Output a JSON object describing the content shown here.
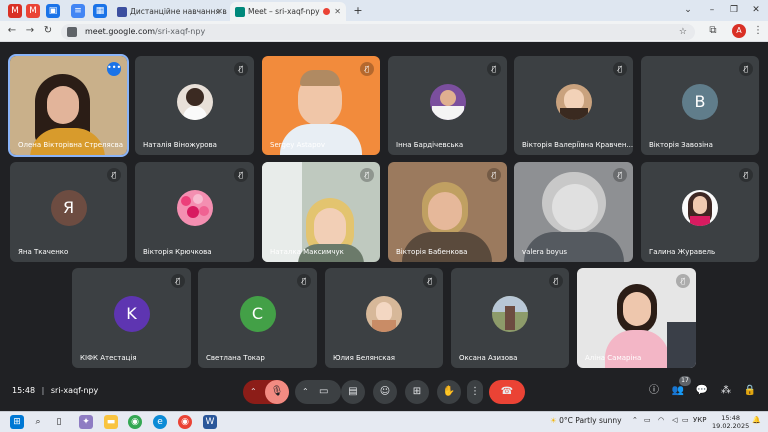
{
  "browser": {
    "tabs": [
      {
        "label": "",
        "color": "#d93025"
      },
      {
        "label": "",
        "color": "#ea4335"
      },
      {
        "label": "",
        "color": "#1a73e8"
      },
      {
        "label": "",
        "color": "#4285f4"
      },
      {
        "label": "",
        "color": "#1a73e8"
      },
      {
        "label": "Дистанційне навчання в ВСП",
        "color": "#3c4fa0"
      },
      {
        "label": "Meet – sri-xaqf-npy",
        "color": "#00897b"
      }
    ],
    "new_tab": "+",
    "window_controls": [
      "⌄",
      "–",
      "❐",
      "✕"
    ],
    "url_host": "meet.google.com",
    "url_path": "/sri-xaqf-npy",
    "profile_initial": "A"
  },
  "participants": [
    {
      "name": "Олена Вікторівна Стрелясва",
      "type": "video",
      "speaking": true
    },
    {
      "name": "Наталія Віножурова",
      "type": "photo",
      "color": "#e8e0d8"
    },
    {
      "name": "Sergey Astapov",
      "type": "video"
    },
    {
      "name": "Інна Бардічевська",
      "type": "photo",
      "color": "#7b4f9e"
    },
    {
      "name": "Вікторія Валеріївна Кравчен...",
      "type": "photo",
      "color": "#c9a27e"
    },
    {
      "name": "Вікторія Завозіна",
      "type": "letter",
      "letter": "B",
      "color": "#607d8b"
    },
    {
      "name": "Яна Ткаченко",
      "type": "letter",
      "letter": "Я",
      "color": "#6d4c41"
    },
    {
      "name": "Вікторія Крючкова",
      "type": "photo",
      "color": "#f48fb1"
    },
    {
      "name": "Наталка Максимчук",
      "type": "video"
    },
    {
      "name": "Вікторія Бабенкова",
      "type": "video"
    },
    {
      "name": "valera boyus",
      "type": "video"
    },
    {
      "name": "Галина Журавель",
      "type": "photo",
      "color": "#3e2723"
    },
    {
      "name": "КІФК Атестація",
      "type": "letter",
      "letter": "K",
      "color": "#5e35b1"
    },
    {
      "name": "Светлана Токар",
      "type": "letter",
      "letter": "C",
      "color": "#43a047"
    },
    {
      "name": "Юлия Белянская",
      "type": "photo",
      "color": "#d7b899"
    },
    {
      "name": "Оксана Азизова",
      "type": "photo",
      "color": "#8d9b6a"
    },
    {
      "name": "Аліна Самаріна",
      "type": "video"
    }
  ],
  "meeting": {
    "time": "15:48",
    "code": "sri-xaqf-npy",
    "people_count": "17"
  },
  "taskbar": {
    "weather": "0°C  Partly sunny",
    "lang": "УКР",
    "time": "15:48",
    "date": "19.02.2025"
  }
}
